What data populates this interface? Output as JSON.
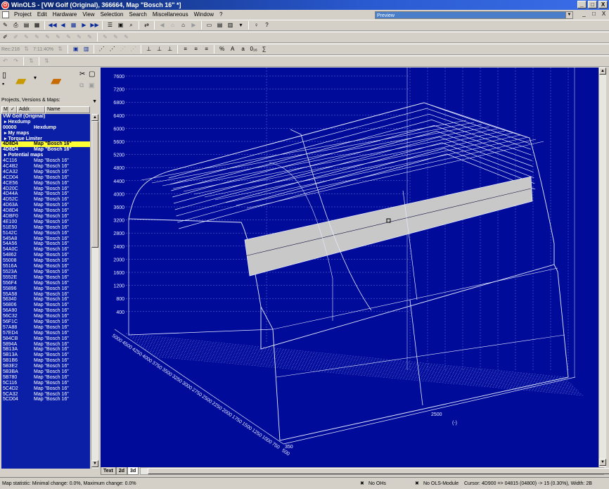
{
  "window": {
    "title": "WinOLS - [VW Golf (Original), 366664, Map \"Bosch 16\" *]",
    "controls": [
      "_",
      "□",
      "X"
    ]
  },
  "menu": {
    "items": [
      "Project",
      "Edit",
      "Hardware",
      "View",
      "Selection",
      "Search",
      "Miscellaneous",
      "Window",
      "?"
    ],
    "preview_label": "Preview",
    "mdi_controls": [
      "_",
      "□",
      "X"
    ]
  },
  "toolbar2": {
    "field1": "Rec:218",
    "field2": "7:11:40%"
  },
  "leftpanel": {
    "section_label": "Projects, Versions & Maps:",
    "columns": [
      "M",
      "✓",
      "Addr.",
      "Name"
    ],
    "rows": [
      {
        "type": "project",
        "addr": "VW Golf (Original)",
        "name": ""
      },
      {
        "type": "group",
        "addr": "Hexdump",
        "name": ""
      },
      {
        "type": "bold",
        "addr": "00000",
        "name": "Hexdump"
      },
      {
        "type": "group",
        "addr": "My maps",
        "name": ""
      },
      {
        "type": "group",
        "addr": "Torque Limiter",
        "name": ""
      },
      {
        "type": "sel",
        "addr": "4D8D4",
        "name": "Map \"Bosch 16\""
      },
      {
        "type": "bold",
        "addr": "4D8D4",
        "name": "Map \"Bosch 16\""
      },
      {
        "type": "group",
        "addr": "Potential maps",
        "name": ""
      },
      {
        "type": "row",
        "addr": "4C116",
        "name": "Map \"Bosch 16\""
      },
      {
        "type": "row",
        "addr": "4C4B2",
        "name": "Map \"Bosch 16\""
      },
      {
        "type": "row",
        "addr": "4CA32",
        "name": "Map \"Bosch 16\""
      },
      {
        "type": "row",
        "addr": "4CD04",
        "name": "Map \"Bosch 16\""
      },
      {
        "type": "row",
        "addr": "4CE56",
        "name": "Map \"Bosch 16\""
      },
      {
        "type": "row",
        "addr": "4D20C",
        "name": "Map \"Bosch 16\""
      },
      {
        "type": "row",
        "addr": "4D44A",
        "name": "Map \"Bosch 16\""
      },
      {
        "type": "row",
        "addr": "4D52C",
        "name": "Map \"Bosch 16\""
      },
      {
        "type": "row",
        "addr": "4D63A",
        "name": "Map \"Bosch 16\""
      },
      {
        "type": "row",
        "addr": "4D8D4",
        "name": "Map \"Bosch 16\""
      },
      {
        "type": "row",
        "addr": "4DBF0",
        "name": "Map \"Bosch 16\""
      },
      {
        "type": "row",
        "addr": "4E100",
        "name": "Map \"Bosch 16\""
      },
      {
        "type": "row",
        "addr": "51E50",
        "name": "Map \"Bosch 16\""
      },
      {
        "type": "row",
        "addr": "5142C",
        "name": "Map \"Bosch 16\""
      },
      {
        "type": "row",
        "addr": "545A8",
        "name": "Map \"Bosch 16\""
      },
      {
        "type": "row",
        "addr": "54A56",
        "name": "Map \"Bosch 16\""
      },
      {
        "type": "row",
        "addr": "54A0C",
        "name": "Map \"Bosch 16\""
      },
      {
        "type": "row",
        "addr": "54862",
        "name": "Map \"Bosch 16\""
      },
      {
        "type": "row",
        "addr": "55008",
        "name": "Map \"Bosch 16\""
      },
      {
        "type": "row",
        "addr": "5516A",
        "name": "Map \"Bosch 16\""
      },
      {
        "type": "row",
        "addr": "5523A",
        "name": "Map \"Bosch 16\""
      },
      {
        "type": "row",
        "addr": "5552E",
        "name": "Map \"Bosch 16\""
      },
      {
        "type": "row",
        "addr": "556F4",
        "name": "Map \"Bosch 16\""
      },
      {
        "type": "row",
        "addr": "55896",
        "name": "Map \"Bosch 16\""
      },
      {
        "type": "row",
        "addr": "55A58",
        "name": "Map \"Bosch 16\""
      },
      {
        "type": "row",
        "addr": "56340",
        "name": "Map \"Bosch 16\""
      },
      {
        "type": "row",
        "addr": "56806",
        "name": "Map \"Bosch 16\""
      },
      {
        "type": "row",
        "addr": "56A90",
        "name": "Map \"Bosch 16\""
      },
      {
        "type": "row",
        "addr": "56C32",
        "name": "Map \"Bosch 16\""
      },
      {
        "type": "row",
        "addr": "56F1C",
        "name": "Map \"Bosch 16\""
      },
      {
        "type": "row",
        "addr": "57A88",
        "name": "Map \"Bosch 16\""
      },
      {
        "type": "row",
        "addr": "57ED4",
        "name": "Map \"Bosch 16\""
      },
      {
        "type": "row",
        "addr": "584CB",
        "name": "Map \"Bosch 16\""
      },
      {
        "type": "row",
        "addr": "5894A",
        "name": "Map \"Bosch 16\""
      },
      {
        "type": "row",
        "addr": "5B13A",
        "name": "Map \"Bosch 16\""
      },
      {
        "type": "row",
        "addr": "5B13A",
        "name": "Map \"Bosch 16\""
      },
      {
        "type": "row",
        "addr": "5B1B6",
        "name": "Map \"Bosch 16\""
      },
      {
        "type": "row",
        "addr": "5B3E2",
        "name": "Map \"Bosch 16\""
      },
      {
        "type": "row",
        "addr": "5B3BA",
        "name": "Map \"Bosch 16\""
      },
      {
        "type": "row",
        "addr": "5B780",
        "name": "Map \"Bosch 16\""
      },
      {
        "type": "row",
        "addr": "5C116",
        "name": "Map \"Bosch 16\""
      },
      {
        "type": "row",
        "addr": "5C4D2",
        "name": "Map \"Bosch 16\""
      },
      {
        "type": "row",
        "addr": "5CA32",
        "name": "Map \"Bosch 16\""
      },
      {
        "type": "row",
        "addr": "5CD04",
        "name": "Map \"Bosch 16\""
      }
    ]
  },
  "chart": {
    "y_ticks": [
      "7600",
      "7200",
      "6800",
      "6400",
      "6000",
      "5600",
      "5200",
      "4800",
      "4400",
      "4000",
      "3600",
      "3200",
      "2800",
      "2400",
      "2000",
      "1600",
      "1200",
      "800",
      "400"
    ],
    "x_ticks": [
      "5000",
      "4500",
      "4250",
      "4000",
      "3750",
      "3500",
      "3250",
      "3000",
      "2750",
      "2500",
      "2250",
      "2000",
      "1750",
      "1500",
      "1250",
      "1000",
      "750",
      "500"
    ],
    "z_labels": [
      "350",
      "2500",
      "(-)"
    ]
  },
  "tabs": [
    "Text",
    "2d",
    "3d"
  ],
  "status": {
    "left": "Map statistic: Minimal change: 0.0%, Maximum change: 0.0%",
    "ohs": "No OHs",
    "module": "No OLS-Module",
    "cursor": "Cursor: 4D900 => 04815 (04800) -> 15 (0.30%), Width: 2B"
  }
}
